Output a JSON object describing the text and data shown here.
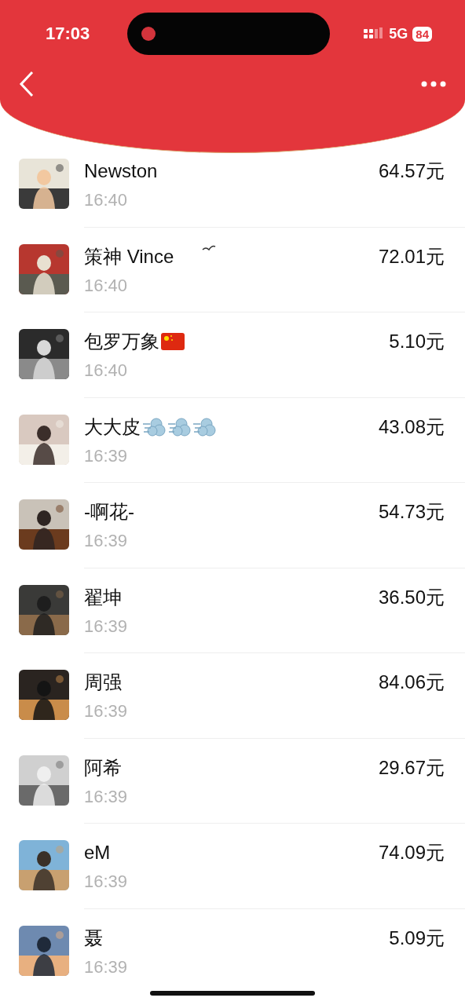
{
  "status_bar": {
    "time": "17:03",
    "network": "5G",
    "battery": "84"
  },
  "records": [
    {
      "name": "Newston",
      "time": "16:40",
      "amount": "64.57元"
    },
    {
      "name": "策神 Vince",
      "time": "16:40",
      "amount": "72.01元",
      "marks": [
        {
          "kind": "bird"
        }
      ]
    },
    {
      "name": "包罗万象",
      "time": "16:40",
      "amount": "5.10元",
      "marks": [
        {
          "kind": "flag"
        }
      ]
    },
    {
      "name": "大大皮",
      "time": "16:39",
      "amount": "43.08元",
      "marks": [
        {
          "kind": "puff"
        },
        {
          "kind": "puff"
        },
        {
          "kind": "puff"
        }
      ]
    },
    {
      "name": "-啊花-",
      "time": "16:39",
      "amount": "54.73元"
    },
    {
      "name": "翟坤",
      "time": "16:39",
      "amount": "36.50元"
    },
    {
      "name": "周强",
      "time": "16:39",
      "amount": "84.06元"
    },
    {
      "name": "阿希",
      "time": "16:39",
      "amount": "29.67元"
    },
    {
      "name": "eM",
      "time": "16:39",
      "amount": "74.09元"
    },
    {
      "name": "聂",
      "time": "16:39",
      "amount": "5.09元"
    }
  ]
}
